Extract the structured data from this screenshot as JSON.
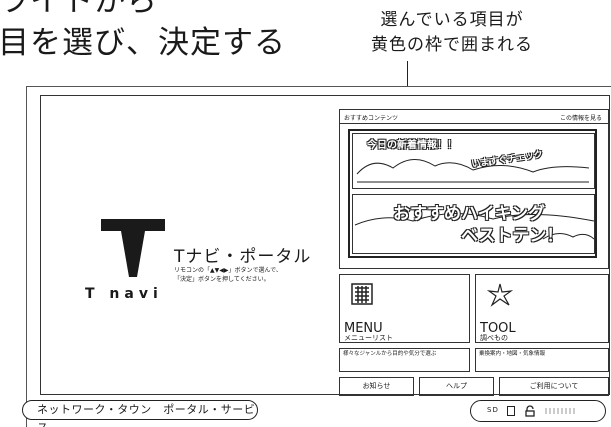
{
  "heading": {
    "line1": "ライトから",
    "line2": "目を選び、決定する"
  },
  "caption": {
    "line1": "選んでいる項目が",
    "line2": "黄色の枠で囲まれる"
  },
  "logo": {
    "text": "T navi"
  },
  "portal": {
    "title": "Tナビ・ポータル",
    "desc_line1": "リモコンの「▲▼◀▶」ボタンで選んで、",
    "desc_line2": "「決定」ボタンを押してください。"
  },
  "recommend": {
    "title": "おすすめコンテンツ",
    "more": "この情報を見る",
    "banner1_line1": "今日の新着情報！！",
    "banner1_line2": "いますぐチェック",
    "banner2_line1": "おすすめハイキング",
    "banner2_line2": "ベストテン！"
  },
  "menu": {
    "label": "MENU",
    "sub": "メニューリスト",
    "desc": "様々なジャンルから目的や気分で選ぶ",
    "icon": "grid-icon"
  },
  "tool": {
    "label": "TOOL",
    "sub": "調べもの",
    "desc": "乗換案内・地図・気象情報",
    "icon": "sparkle-icon"
  },
  "buttons": {
    "news": "お知らせ",
    "help": "ヘルプ",
    "terms": "ご利用について"
  },
  "statusbar": {
    "service": "ネットワーク・タウン　ポータル・サービス",
    "sd": "SD"
  }
}
